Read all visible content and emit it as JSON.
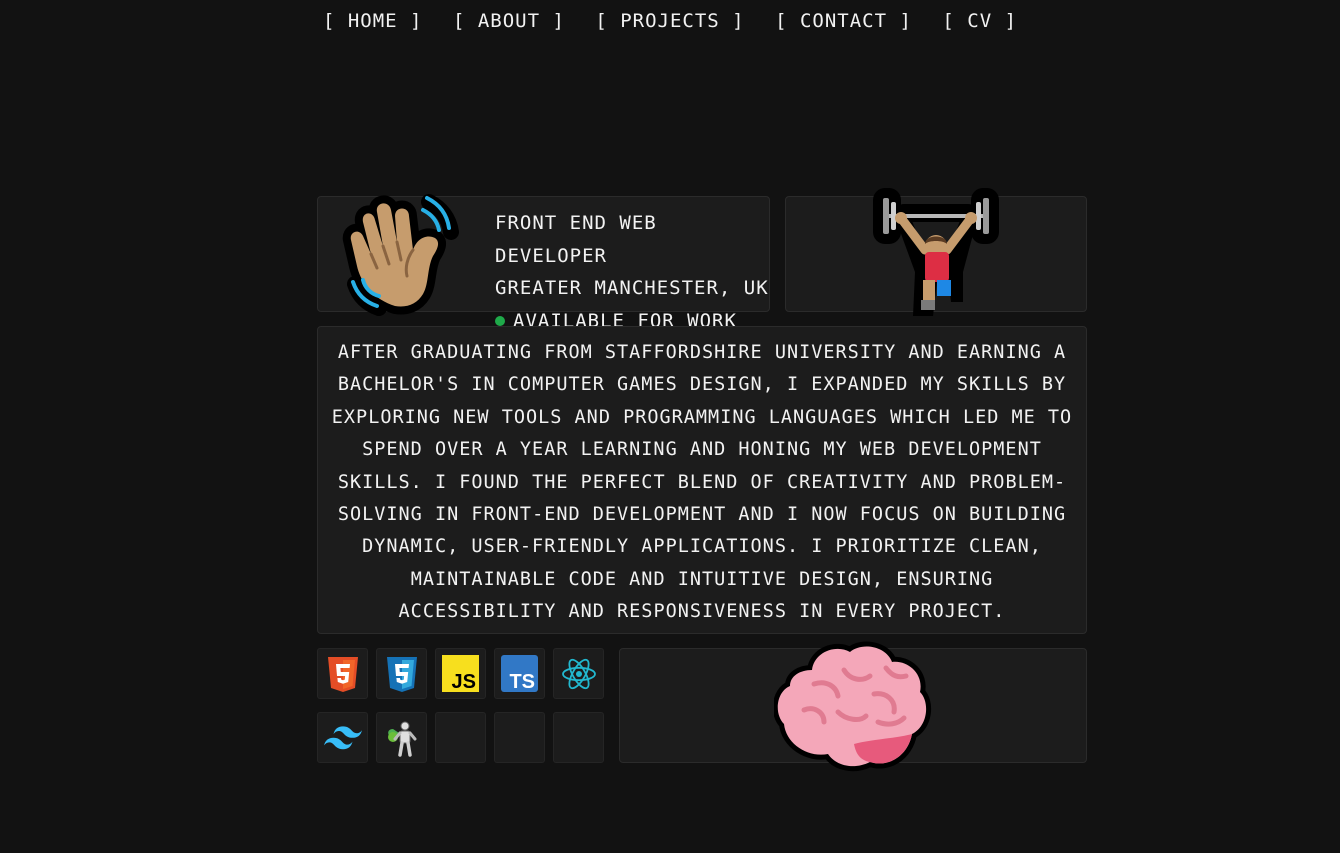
{
  "nav": {
    "items": [
      "[ HOME ]",
      "[ ABOUT ]",
      "[ PROJECTS ]",
      "[ CONTACT ]",
      "[ CV ]"
    ]
  },
  "intro": {
    "role": "FRONT END WEB DEVELOPER",
    "location": "GREATER MANCHESTER, UK",
    "status": "AVAILABLE FOR WORK",
    "status_color": "#1faa4a"
  },
  "about": {
    "text": "AFTER GRADUATING FROM STAFFORDSHIRE UNIVERSITY AND EARNING A BACHELOR'S IN COMPUTER GAMES DESIGN, I EXPANDED MY SKILLS BY EXPLORING NEW TOOLS AND PROGRAMMING LANGUAGES WHICH LED ME TO SPEND OVER A YEAR LEARNING AND HONING MY WEB DEVELOPMENT SKILLS. I FOUND THE PERFECT BLEND OF CREATIVITY AND PROBLEM-SOLVING IN FRONT-END DEVELOPMENT AND I NOW FOCUS ON BUILDING DYNAMIC, USER-FRIENDLY APPLICATIONS. I PRIORITIZE CLEAN, MAINTAINABLE CODE AND INTUITIVE DESIGN, ENSURING ACCESSIBILITY AND RESPONSIVENESS IN EVERY PROJECT."
  },
  "skills": {
    "icons": [
      "html5-icon",
      "css3-icon",
      "javascript-icon",
      "typescript-icon",
      "react-icon",
      "tailwind-icon",
      "testing-robot-icon",
      "empty-slot",
      "empty-slot",
      "empty-slot"
    ],
    "js_label": "JS",
    "ts_label": "TS",
    "html_label": "5",
    "css_label": "3"
  },
  "colors": {
    "background": "#121212",
    "card": "#1c1c1c",
    "html5": "#e44d26",
    "css3": "#1572b6",
    "javascript": "#f7df1e",
    "typescript": "#3178c6",
    "react": "#22b8cf",
    "tailwind": "#38bdf8"
  }
}
